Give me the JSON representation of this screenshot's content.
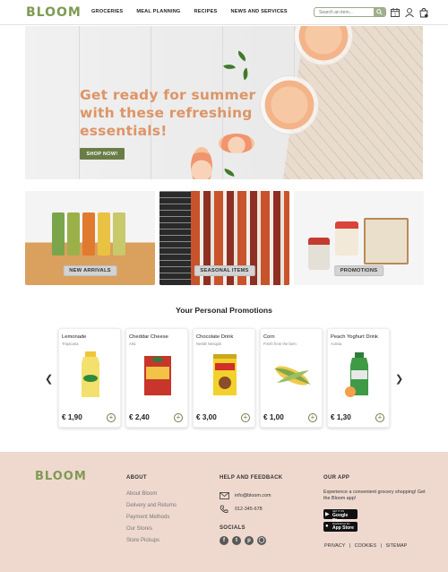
{
  "header": {
    "logo": "BLOOM",
    "nav": [
      "GROCERIES",
      "MEAL PLANNING",
      "RECIPES",
      "NEWS AND SERVICES"
    ],
    "search_placeholder": "Search an item..."
  },
  "hero": {
    "title": "Get ready for summer with these refreshing essentials!",
    "button": "SHOP NOW!"
  },
  "categories": [
    {
      "label": "NEW ARRIVALS"
    },
    {
      "label": "SEASONAL ITEMS"
    },
    {
      "label": "PROMOTIONS"
    }
  ],
  "promotions": {
    "title": "Your Personal Promotions",
    "products": [
      {
        "name": "Lemonade",
        "brand": "Tropicana",
        "price": "€ 1,90"
      },
      {
        "name": "Cheddar Cheese",
        "brand": "Arla",
        "price": "€ 2,40"
      },
      {
        "name": "Chocolate Drink",
        "brand": "Nestlé Nesquik",
        "price": "€ 3,00"
      },
      {
        "name": "Corn",
        "brand": "Fresh from the farm",
        "price": "€ 1,00"
      },
      {
        "name": "Peach Yoghurt Drink",
        "brand": "Activia",
        "price": "€ 1,30"
      }
    ]
  },
  "footer": {
    "logo": "BLOOM",
    "about_title": "ABOUT",
    "about_links": [
      "About Bloom",
      "Delivery and Returns",
      "Payment Methods",
      "Our Stores",
      "Store Pickups"
    ],
    "help_title": "HELP AND FEEDBACK",
    "email": "info@bloom.com",
    "phone": "012-345-678",
    "socials_title": "SOCIALS",
    "app_title": "OUR APP",
    "app_text": "Experience a convenient grocery shopping! Get the Bloom app!",
    "google_small": "GET IT ON",
    "google_big": "Google Play",
    "apple_small": "Download on the",
    "apple_big": "App Store",
    "legal": [
      "PRIVACY",
      "COOKIES",
      "SITEMAP"
    ]
  },
  "colors": {
    "brand": "#7f9a52",
    "hero_text": "#dd9566",
    "button": "#6a7d47",
    "footer_bg": "#efd9cf"
  }
}
